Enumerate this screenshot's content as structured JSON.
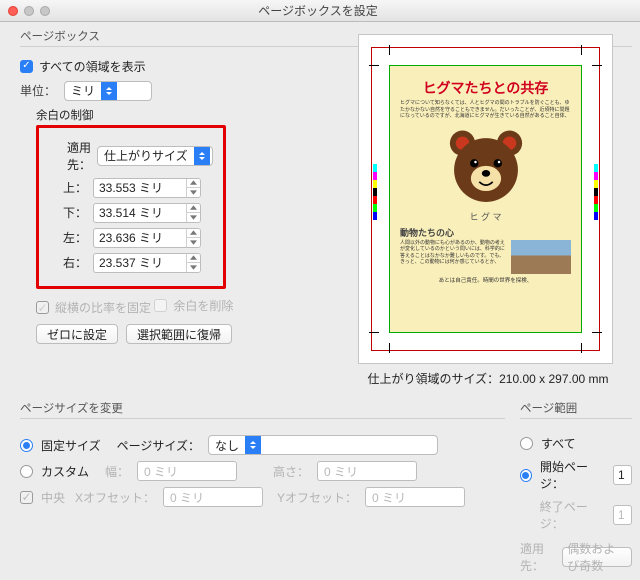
{
  "window": {
    "title": "ページボックスを設定"
  },
  "section1": {
    "label": "ページボックス"
  },
  "showAll": {
    "label": "すべての領域を表示"
  },
  "unit": {
    "label": "単位：",
    "value": "ミリ"
  },
  "margins": {
    "label": "余白の制御",
    "target_label": "適用先：",
    "target_value": "仕上がりサイズ",
    "top_label": "上：",
    "top_value": "33.553 ミリ",
    "bottom_label": "下：",
    "bottom_value": "33.514 ミリ",
    "left_label": "左：",
    "left_value": "23.636 ミリ",
    "right_label": "右：",
    "right_value": "23.537 ミリ",
    "lock_aspect": "縦横の比率を固定",
    "remove_white": "余白を削除",
    "zero_btn": "ゼロに設定",
    "revert_btn": "選択範囲に復帰"
  },
  "preview": {
    "title": "ヒグマたちとの共存",
    "paragraph": "ヒグマについて知らなくては、人とヒグマの間のトラブルを防ぐことも、ゆたかなかない自然を守ることもできません。だいったことが、近頃特に問題になっているのですが、北海道にヒグマが生きている自然があること自体、",
    "bear_label": "ヒ グ マ",
    "heading2": "動物たちの心",
    "paragraph2": "人間以外の動物にも心があるのか、動物の考えが変化しているのかという問いには、科学的に答えることはなかなか難しいものです。でも、きっと、この動物には何か感じているとか、",
    "footer": "あとは自己責任。時間の世界を探検、",
    "caption": "仕上がり領域のサイズ：210.00 x 297.00  mm"
  },
  "pagesize": {
    "section": "ページサイズを変更",
    "fixed": "固定サイズ",
    "pagesize_label": "ページサイズ：",
    "pagesize_value": "なし",
    "custom": "カスタム",
    "width_label": "幅：",
    "height_label": "高さ：",
    "center": "中央",
    "xoffset_label": "Xオフセット：",
    "yoffset_label": "Yオフセット：",
    "zero_mm": "0 ミリ"
  },
  "range": {
    "section": "ページ範囲",
    "all": "すべて",
    "start_label": "開始ページ：",
    "start_value": "1",
    "end_label": "終了ページ：",
    "end_value": "1",
    "apply_label": "適用先：",
    "apply_value": "偶数および奇数"
  }
}
